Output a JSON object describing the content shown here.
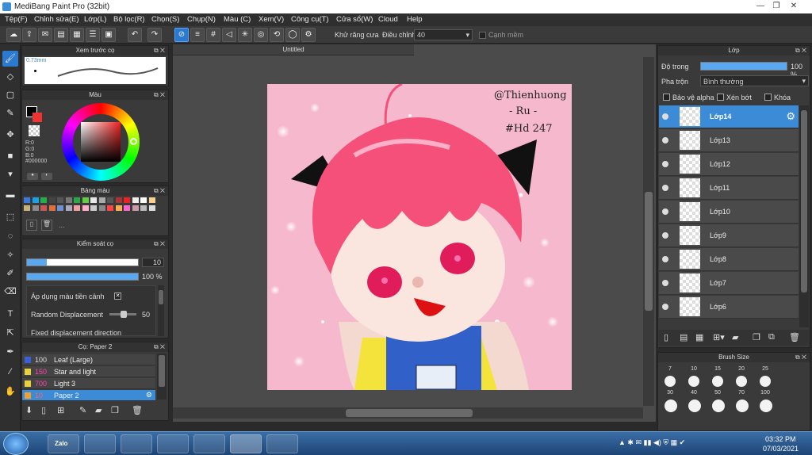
{
  "window": {
    "title": "MediBang Paint Pro (32bit)",
    "min": "—",
    "restore": "❐",
    "close": "✕"
  },
  "menu": [
    "Tệp(F)",
    "Chỉnh sửa(E)",
    "Lớp(L)",
    "Bộ lọc(R)",
    "Chọn(S)",
    "Chụp(N)",
    "Màu (C)",
    "Xem(V)",
    "Công cụ(T)",
    "Cửa sổ(W)",
    "Cloud",
    "Help"
  ],
  "toolbar": {
    "antialias_label": "Khử răng cưa",
    "correction_label": "Điều chỉnh",
    "correction_value": "40",
    "snap_label": "Cạnh mềm"
  },
  "document": {
    "tab": "Untitled"
  },
  "preview_panel": {
    "title": "Xem trước cọ",
    "size": "0.73mm"
  },
  "color_panel": {
    "title": "Màu",
    "r": "R:0",
    "g": "G:0",
    "b": "B:0",
    "hex": "#000000"
  },
  "palette_panel": {
    "title": "Bảng màu",
    "more": "..."
  },
  "brush_control": {
    "title": "Kiểm soát cọ",
    "size_value": "10",
    "opacity_value": "100 %",
    "apply_fg": "Áp dụng màu tiền cảnh",
    "random_disp": "Random Displacement",
    "random_value": "50",
    "fixed_disp": "Fixed displacement direction"
  },
  "brush_panel": {
    "title": "Cọ: Paper 2",
    "items": [
      {
        "size": "100",
        "name": "Leaf (Large)",
        "color": "#3a5fd8"
      },
      {
        "size": "150",
        "name": "Star and light",
        "color": "#e8d23a"
      },
      {
        "size": "700",
        "name": "Light 3",
        "color": "#e8d23a"
      },
      {
        "size": "10",
        "name": "Paper 2",
        "color": "#f0a030"
      }
    ]
  },
  "layer_panel": {
    "title": "Lớp",
    "opacity_label": "Độ trong",
    "opacity_value": "100 %",
    "blend_label": "Pha trộn",
    "blend_value": "Bình thường",
    "protect_alpha": "Bảo vệ alpha",
    "clipping": "Xén bớt",
    "lock": "Khóa",
    "layers": [
      "Lớp14",
      "Lớp13",
      "Lớp12",
      "Lớp11",
      "Lớp10",
      "Lớp9",
      "Lớp8",
      "Lớp7",
      "Lớp6"
    ]
  },
  "brush_size_panel": {
    "title": "Brush Size",
    "sizes_row1": [
      "7",
      "10",
      "15",
      "20",
      "25"
    ],
    "sizes_row2": [
      "30",
      "40",
      "50",
      "70",
      "100"
    ]
  },
  "artwork": {
    "signature_line1": "@Thienhuong",
    "signature_line2": "- Ru -",
    "signature_line3": "#Hd 247"
  },
  "taskbar": {
    "time": "03:32 PM",
    "date": "07/03/2021",
    "zalo": "Zalo"
  }
}
